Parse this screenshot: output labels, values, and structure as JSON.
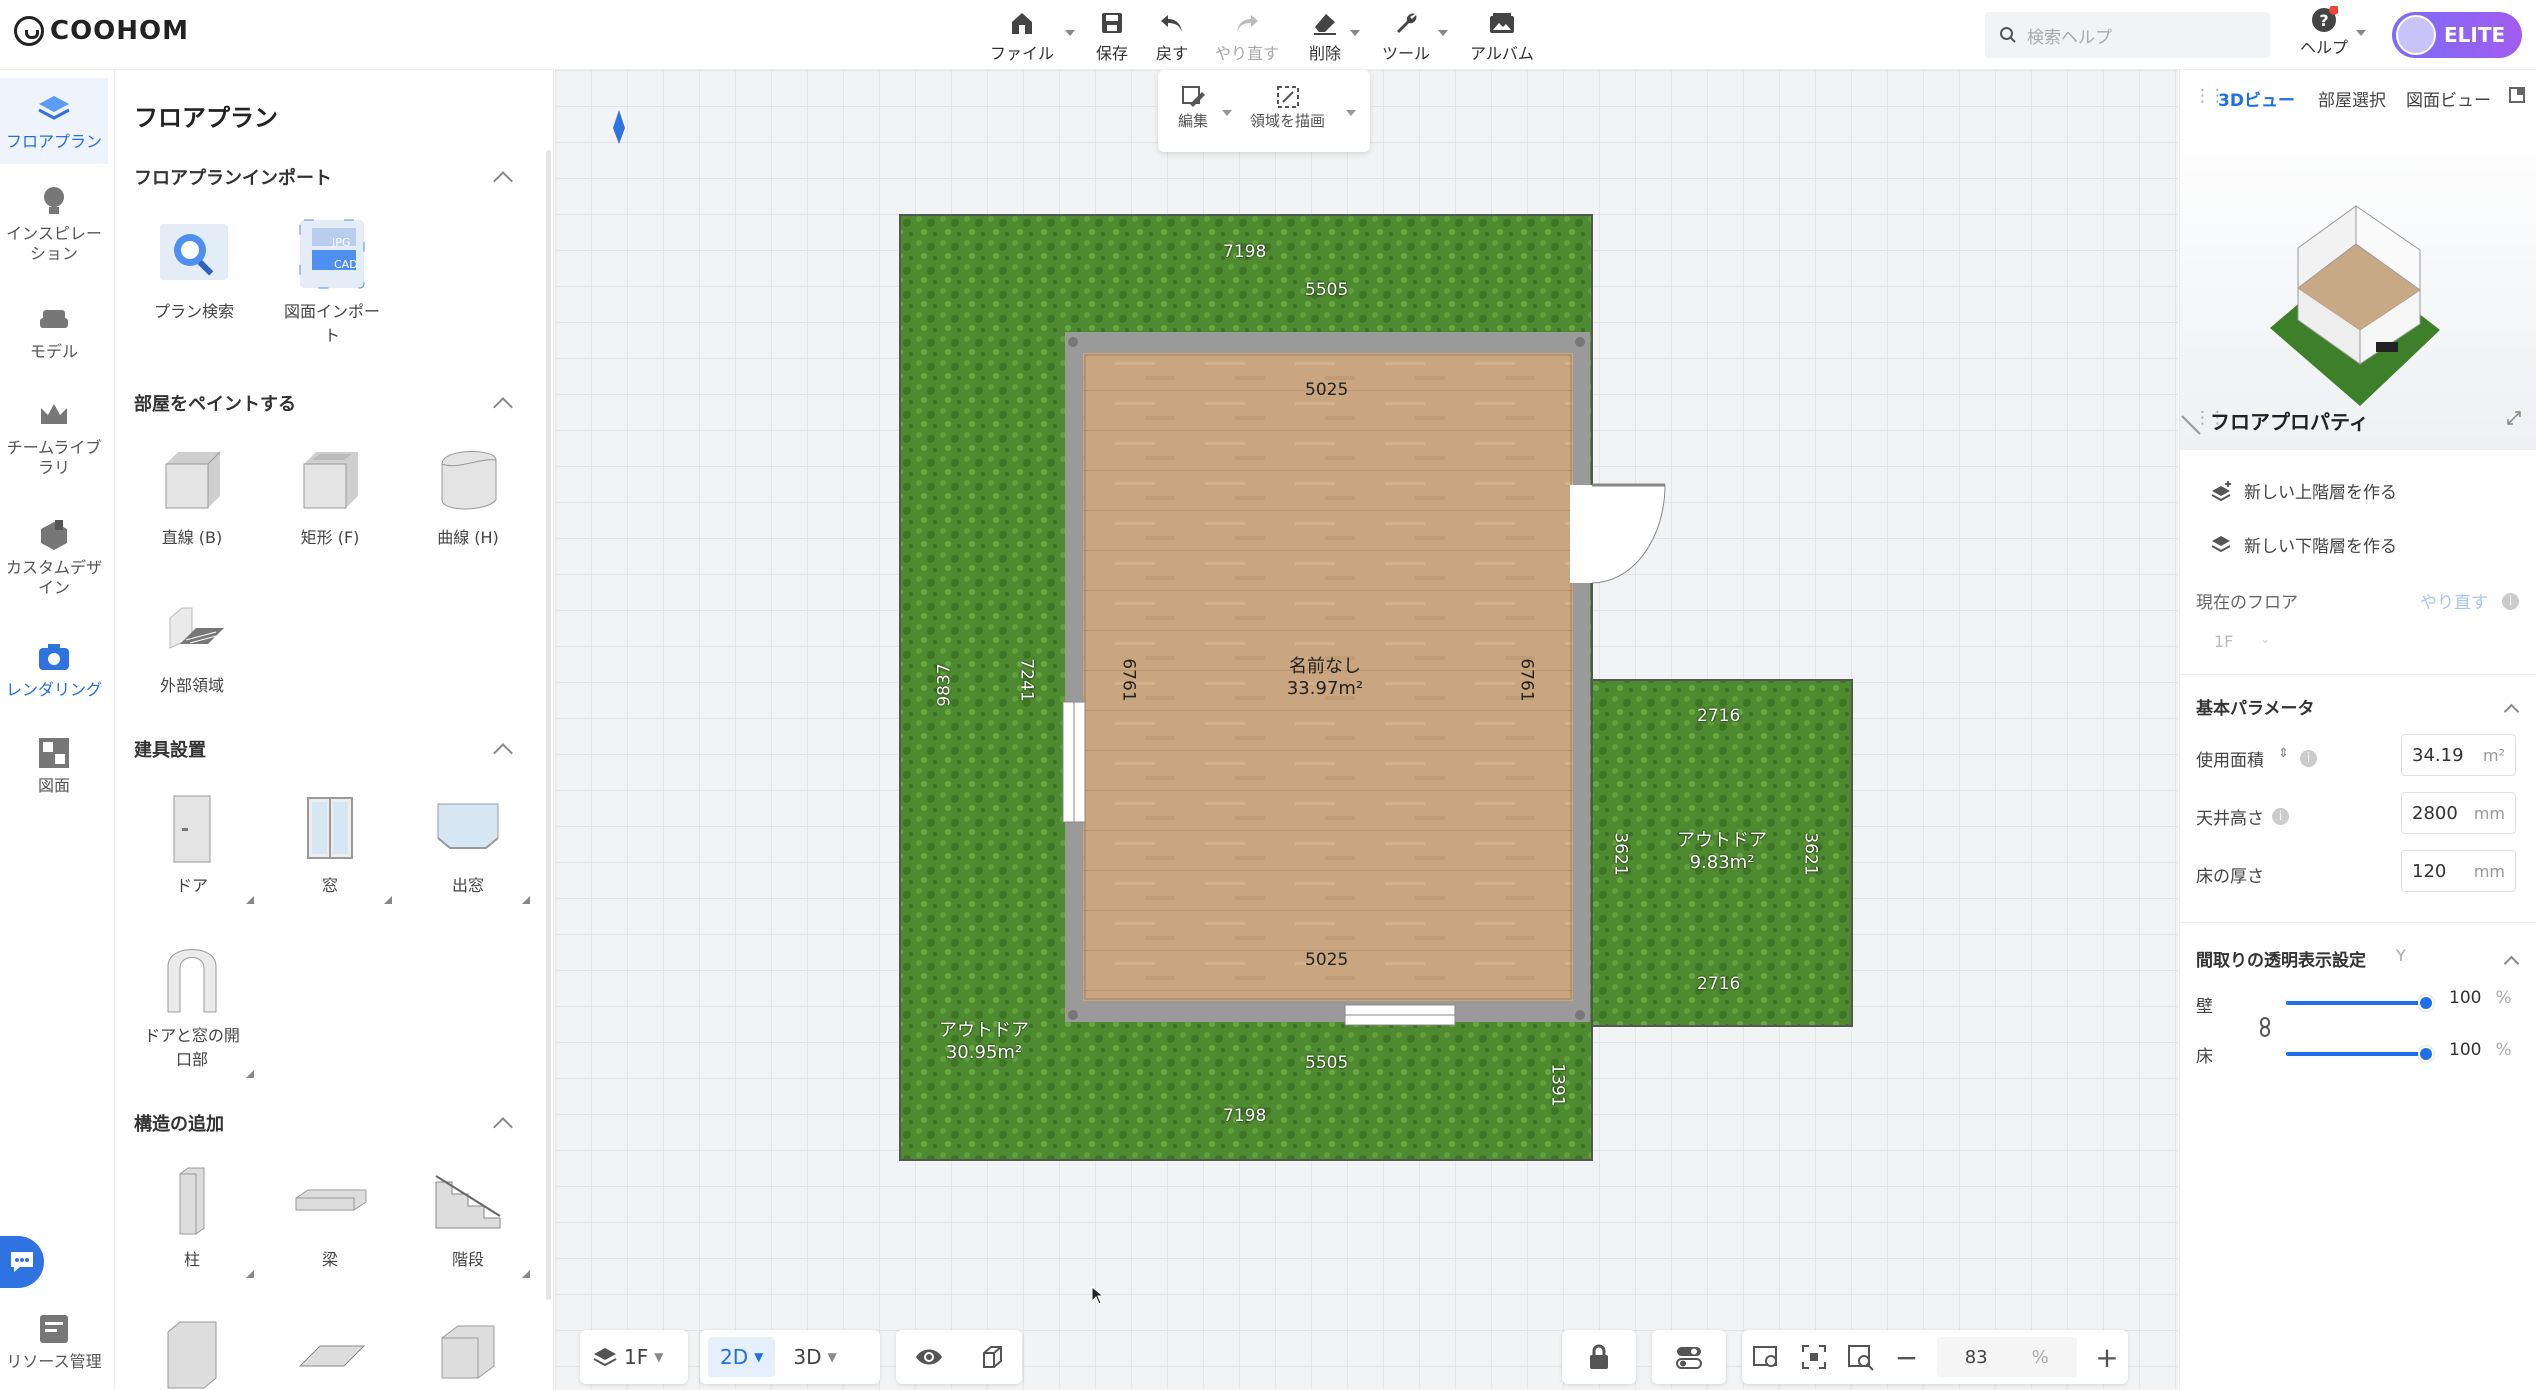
{
  "app": {
    "logo": "COOHOM"
  },
  "toolbar": {
    "file": "ファイル",
    "save": "保存",
    "undo": "戻す",
    "redo": "やり直す",
    "delete": "削除",
    "tools": "ツール",
    "album": "アルバム"
  },
  "search": {
    "placeholder": "検索ヘルプ"
  },
  "help": {
    "label": "ヘルプ"
  },
  "account": {
    "badge": "ELITE"
  },
  "rail": {
    "items": [
      {
        "label": "フロアプラン"
      },
      {
        "label": "インスピレーション"
      },
      {
        "label": "モデル"
      },
      {
        "label": "チームライブラリ"
      },
      {
        "label": "カスタムデザイン"
      },
      {
        "label": "レンダリング"
      },
      {
        "label": "図面"
      },
      {
        "label": "リソース管理"
      }
    ]
  },
  "library": {
    "title": "フロアプラン",
    "import_section": {
      "title": "フロアプランインポート",
      "items": [
        "プラン検索",
        "図面インポート"
      ]
    },
    "import_badges": {
      "jpg": "JPG",
      "cad": "CAD"
    },
    "paint_section": {
      "title": "部屋をペイントする",
      "items": [
        "直線 (B)",
        "矩形 (F)",
        "曲線 (H)",
        "外部領域"
      ]
    },
    "fixtures_section": {
      "title": "建具設置",
      "items": [
        "ドア",
        "窓",
        "出窓",
        "ドアと窓の開口部"
      ]
    },
    "structure_section": {
      "title": "構造の追加",
      "items": [
        "柱",
        "梁",
        "階段"
      ]
    }
  },
  "editbox": {
    "edit": "編集",
    "draw_area": "領域を描画"
  },
  "plan": {
    "outer_top": "7198",
    "outer_top_inner": "5505",
    "outer_bottom": "7198",
    "outer_bottom_inner": "5505",
    "outer_left": "9837",
    "outer_left_inner": "7241",
    "outer_right_small": "1391",
    "room_top": "5025",
    "room_bottom": "5025",
    "room_left": "6761",
    "room_right": "6761",
    "room_name": "名前なし",
    "room_area": "33.97m²",
    "ext_top": "2716",
    "ext_bottom": "2716",
    "ext_left": "3621",
    "ext_right": "3621",
    "ext_name": "アウトドア",
    "ext_area": "9.83m²",
    "outdoor_name": "アウトドア",
    "outdoor_area": "30.95m²"
  },
  "bottom": {
    "floor": "1F",
    "view2d": "2D",
    "view3d": "3D",
    "zoom": "83",
    "zoom_unit": "%"
  },
  "right": {
    "tabs": [
      "3Dビュー",
      "部屋選択",
      "図面ビュー"
    ],
    "props_title": "フロアプロパティ",
    "new_upper": "新しい上階層を作る",
    "new_lower": "新しい下階層を作る",
    "current_floor_label": "現在のフロア",
    "current_floor_action": "やり直す",
    "current_floor_value": "1F",
    "basic_title": "基本パラメータ",
    "area_label": "使用面積",
    "area_value": "34.19",
    "area_unit": "m²",
    "ceiling_label": "天井高さ",
    "ceiling_value": "2800",
    "ceiling_unit": "mm",
    "floor_thick_label": "床の厚さ",
    "floor_thick_value": "120",
    "floor_thick_unit": "mm",
    "transparency_title": "間取りの透明表示設定",
    "transparency_key": "Y",
    "wall_label": "壁",
    "wall_value": "100",
    "wall_fraction": 1.0,
    "floor_label": "床",
    "floor_value": "100",
    "floor_fraction": 1.0,
    "percent": "%"
  },
  "colors": {
    "accent": "#1f6feb",
    "grass": "#4f8a32",
    "wood": "#c9a47f",
    "wall": "#9a9a9a"
  }
}
